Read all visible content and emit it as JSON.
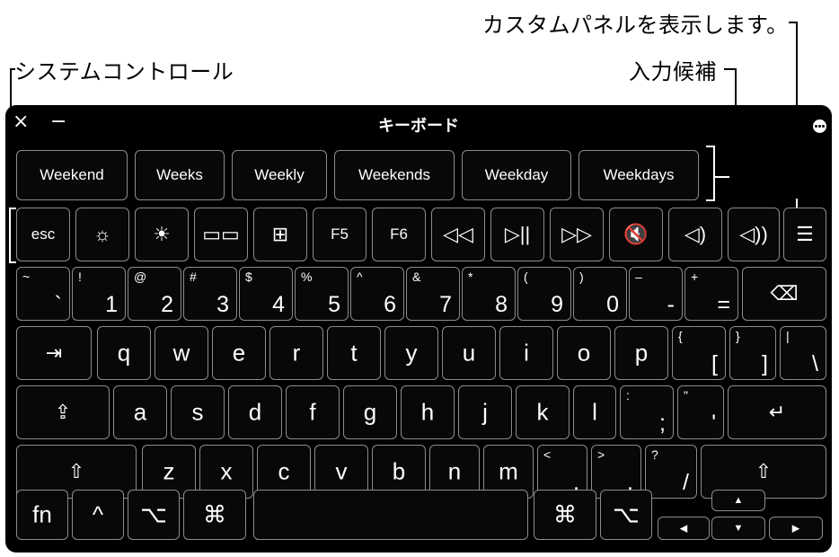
{
  "callouts": {
    "custom_panel": "カスタムパネルを表示します。",
    "system_controls": "システムコントロール",
    "suggestions": "入力候補"
  },
  "window": {
    "title": "キーボード",
    "close": "×",
    "minimize": "−"
  },
  "suggestions": [
    "Weekend",
    "Weeks",
    "Weekly",
    "Weekends",
    "Weekday",
    "Weekdays"
  ],
  "function_row": [
    "esc",
    "☼",
    "☀",
    "▭▭",
    "⊞",
    "F5",
    "F6",
    "◁◁",
    "▷||",
    "▷▷",
    "🔇",
    "◁)",
    "◁))",
    "☰"
  ],
  "number_row": [
    {
      "shift": "~",
      "main": "`"
    },
    {
      "shift": "!",
      "main": "1"
    },
    {
      "shift": "@",
      "main": "2"
    },
    {
      "shift": "#",
      "main": "3"
    },
    {
      "shift": "$",
      "main": "4"
    },
    {
      "shift": "%",
      "main": "5"
    },
    {
      "shift": "^",
      "main": "6"
    },
    {
      "shift": "&",
      "main": "7"
    },
    {
      "shift": "*",
      "main": "8"
    },
    {
      "shift": "(",
      "main": "9"
    },
    {
      "shift": ")",
      "main": "0"
    },
    {
      "shift": "–",
      "main": "-"
    },
    {
      "shift": "+",
      "main": "="
    }
  ],
  "delete_key": "⌫",
  "tab_key": "⇥",
  "qwerty_row": [
    "q",
    "w",
    "e",
    "r",
    "t",
    "y",
    "u",
    "i",
    "o",
    "p"
  ],
  "bracket_keys": [
    {
      "shift": "{",
      "main": "["
    },
    {
      "shift": "}",
      "main": "]"
    },
    {
      "shift": "|",
      "main": "\\"
    }
  ],
  "caps_key": "⇪",
  "home_row": [
    "a",
    "s",
    "d",
    "f",
    "g",
    "h",
    "j",
    "k",
    "l"
  ],
  "home_punct": [
    {
      "shift": ":",
      "main": ";"
    },
    {
      "shift": "\"",
      "main": "'"
    }
  ],
  "return_key": "↵",
  "shift_key": "⇧",
  "bottom_row": [
    "z",
    "x",
    "c",
    "v",
    "b",
    "n",
    "m"
  ],
  "bottom_punct": [
    {
      "shift": "<",
      "main": ","
    },
    {
      "shift": ">",
      "main": "."
    },
    {
      "shift": "?",
      "main": "/"
    }
  ],
  "modifier_row": {
    "fn": "fn",
    "control": "^",
    "option": "⌥",
    "command": "⌘"
  },
  "arrows": {
    "up": "▲",
    "down": "▼",
    "left": "◀",
    "right": "▶"
  }
}
